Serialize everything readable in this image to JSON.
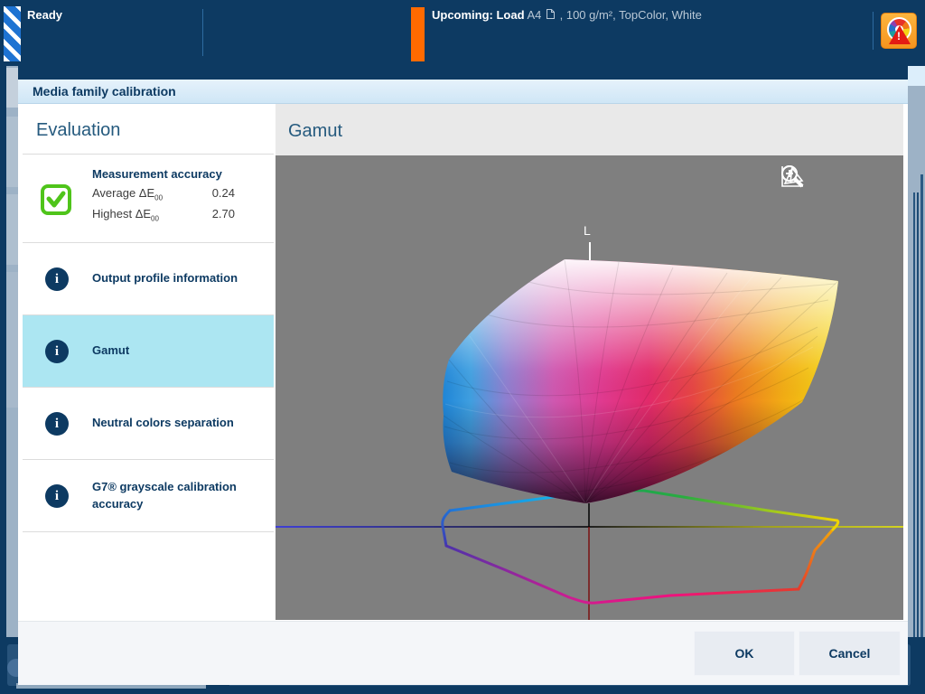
{
  "topbar": {
    "status": "Ready",
    "upcoming_bold": "Upcoming: Load",
    "upcoming_media": "A4",
    "upcoming_rest": ", 100 g/m², TopColor, White"
  },
  "dialog": {
    "title": "Media family calibration",
    "evaluation": {
      "heading": "Evaluation",
      "measurement": {
        "title": "Measurement accuracy",
        "rows": [
          {
            "label": "Average ΔE",
            "sub": "00",
            "value": "0.24"
          },
          {
            "label": "Highest ΔE",
            "sub": "00",
            "value": "2.70"
          }
        ]
      },
      "items": [
        {
          "title": "Output profile information",
          "selected": false
        },
        {
          "title": "Gamut",
          "selected": true
        },
        {
          "title": "Neutral colors separation",
          "selected": false
        },
        {
          "title": "G7® grayscale calibration accuracy",
          "selected": false
        }
      ]
    },
    "gamut": {
      "heading": "Gamut",
      "axis_label": "L",
      "tools": [
        "gamut-3d-view",
        "zoom-out",
        "zoom-in"
      ]
    },
    "footer": {
      "ok": "OK",
      "cancel": "Cancel"
    }
  },
  "colors": {
    "accent_navy": "#0d3a62",
    "selection_cyan": "#ace6f2",
    "success_green": "#4fc41a",
    "alert_orange": "#ff6a00",
    "viewer_gray": "#7f7f7f"
  }
}
